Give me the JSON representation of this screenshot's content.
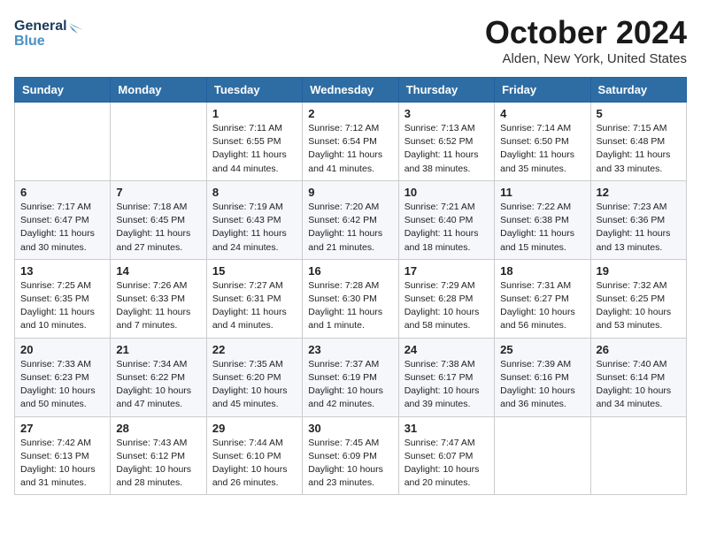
{
  "header": {
    "logo_line1": "General",
    "logo_line2": "Blue",
    "month": "October 2024",
    "location": "Alden, New York, United States"
  },
  "weekdays": [
    "Sunday",
    "Monday",
    "Tuesday",
    "Wednesday",
    "Thursday",
    "Friday",
    "Saturday"
  ],
  "weeks": [
    [
      {
        "day": "",
        "info": ""
      },
      {
        "day": "",
        "info": ""
      },
      {
        "day": "1",
        "info": "Sunrise: 7:11 AM\nSunset: 6:55 PM\nDaylight: 11 hours\nand 44 minutes."
      },
      {
        "day": "2",
        "info": "Sunrise: 7:12 AM\nSunset: 6:54 PM\nDaylight: 11 hours\nand 41 minutes."
      },
      {
        "day": "3",
        "info": "Sunrise: 7:13 AM\nSunset: 6:52 PM\nDaylight: 11 hours\nand 38 minutes."
      },
      {
        "day": "4",
        "info": "Sunrise: 7:14 AM\nSunset: 6:50 PM\nDaylight: 11 hours\nand 35 minutes."
      },
      {
        "day": "5",
        "info": "Sunrise: 7:15 AM\nSunset: 6:48 PM\nDaylight: 11 hours\nand 33 minutes."
      }
    ],
    [
      {
        "day": "6",
        "info": "Sunrise: 7:17 AM\nSunset: 6:47 PM\nDaylight: 11 hours\nand 30 minutes."
      },
      {
        "day": "7",
        "info": "Sunrise: 7:18 AM\nSunset: 6:45 PM\nDaylight: 11 hours\nand 27 minutes."
      },
      {
        "day": "8",
        "info": "Sunrise: 7:19 AM\nSunset: 6:43 PM\nDaylight: 11 hours\nand 24 minutes."
      },
      {
        "day": "9",
        "info": "Sunrise: 7:20 AM\nSunset: 6:42 PM\nDaylight: 11 hours\nand 21 minutes."
      },
      {
        "day": "10",
        "info": "Sunrise: 7:21 AM\nSunset: 6:40 PM\nDaylight: 11 hours\nand 18 minutes."
      },
      {
        "day": "11",
        "info": "Sunrise: 7:22 AM\nSunset: 6:38 PM\nDaylight: 11 hours\nand 15 minutes."
      },
      {
        "day": "12",
        "info": "Sunrise: 7:23 AM\nSunset: 6:36 PM\nDaylight: 11 hours\nand 13 minutes."
      }
    ],
    [
      {
        "day": "13",
        "info": "Sunrise: 7:25 AM\nSunset: 6:35 PM\nDaylight: 11 hours\nand 10 minutes."
      },
      {
        "day": "14",
        "info": "Sunrise: 7:26 AM\nSunset: 6:33 PM\nDaylight: 11 hours\nand 7 minutes."
      },
      {
        "day": "15",
        "info": "Sunrise: 7:27 AM\nSunset: 6:31 PM\nDaylight: 11 hours\nand 4 minutes."
      },
      {
        "day": "16",
        "info": "Sunrise: 7:28 AM\nSunset: 6:30 PM\nDaylight: 11 hours\nand 1 minute."
      },
      {
        "day": "17",
        "info": "Sunrise: 7:29 AM\nSunset: 6:28 PM\nDaylight: 10 hours\nand 58 minutes."
      },
      {
        "day": "18",
        "info": "Sunrise: 7:31 AM\nSunset: 6:27 PM\nDaylight: 10 hours\nand 56 minutes."
      },
      {
        "day": "19",
        "info": "Sunrise: 7:32 AM\nSunset: 6:25 PM\nDaylight: 10 hours\nand 53 minutes."
      }
    ],
    [
      {
        "day": "20",
        "info": "Sunrise: 7:33 AM\nSunset: 6:23 PM\nDaylight: 10 hours\nand 50 minutes."
      },
      {
        "day": "21",
        "info": "Sunrise: 7:34 AM\nSunset: 6:22 PM\nDaylight: 10 hours\nand 47 minutes."
      },
      {
        "day": "22",
        "info": "Sunrise: 7:35 AM\nSunset: 6:20 PM\nDaylight: 10 hours\nand 45 minutes."
      },
      {
        "day": "23",
        "info": "Sunrise: 7:37 AM\nSunset: 6:19 PM\nDaylight: 10 hours\nand 42 minutes."
      },
      {
        "day": "24",
        "info": "Sunrise: 7:38 AM\nSunset: 6:17 PM\nDaylight: 10 hours\nand 39 minutes."
      },
      {
        "day": "25",
        "info": "Sunrise: 7:39 AM\nSunset: 6:16 PM\nDaylight: 10 hours\nand 36 minutes."
      },
      {
        "day": "26",
        "info": "Sunrise: 7:40 AM\nSunset: 6:14 PM\nDaylight: 10 hours\nand 34 minutes."
      }
    ],
    [
      {
        "day": "27",
        "info": "Sunrise: 7:42 AM\nSunset: 6:13 PM\nDaylight: 10 hours\nand 31 minutes."
      },
      {
        "day": "28",
        "info": "Sunrise: 7:43 AM\nSunset: 6:12 PM\nDaylight: 10 hours\nand 28 minutes."
      },
      {
        "day": "29",
        "info": "Sunrise: 7:44 AM\nSunset: 6:10 PM\nDaylight: 10 hours\nand 26 minutes."
      },
      {
        "day": "30",
        "info": "Sunrise: 7:45 AM\nSunset: 6:09 PM\nDaylight: 10 hours\nand 23 minutes."
      },
      {
        "day": "31",
        "info": "Sunrise: 7:47 AM\nSunset: 6:07 PM\nDaylight: 10 hours\nand 20 minutes."
      },
      {
        "day": "",
        "info": ""
      },
      {
        "day": "",
        "info": ""
      }
    ]
  ]
}
